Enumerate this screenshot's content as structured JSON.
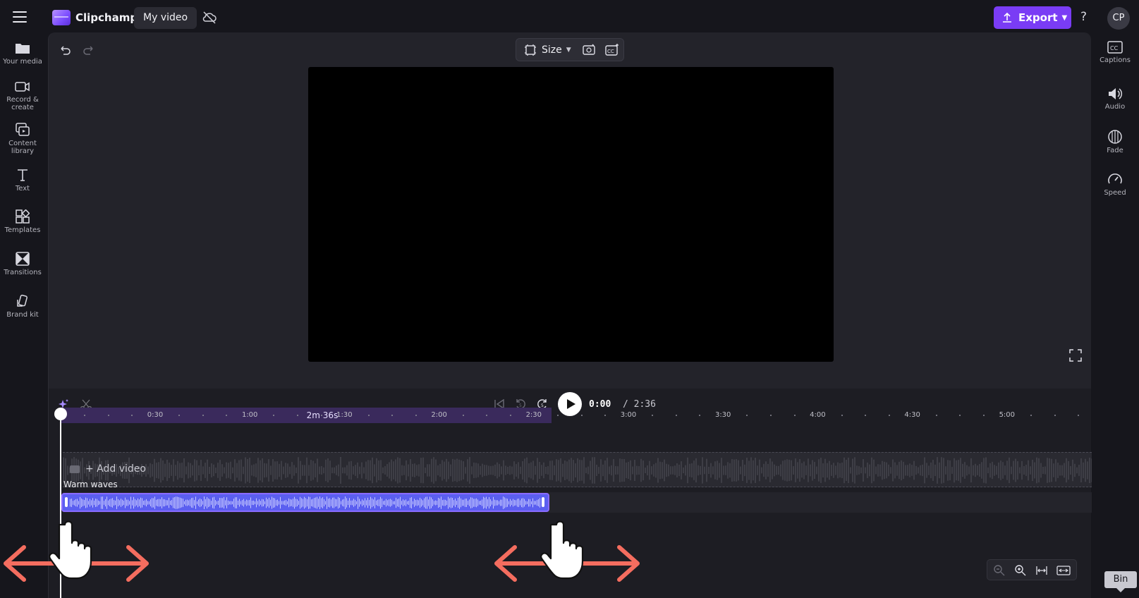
{
  "app": {
    "name": "Clipchamp",
    "project_title": "My video",
    "avatar_initials": "CP",
    "help": "?"
  },
  "export": {
    "label": "Export",
    "color": "#7a3cf5"
  },
  "left_rail": [
    {
      "icon": "folder-icon",
      "label": "Your media"
    },
    {
      "icon": "camera-icon",
      "label": "Record &",
      "label2": "create"
    },
    {
      "icon": "content-library-icon",
      "label": "Content",
      "label2": "library"
    },
    {
      "icon": "text-icon",
      "label": "Text"
    },
    {
      "icon": "templates-icon",
      "label": "Templates"
    },
    {
      "icon": "transitions-icon",
      "label": "Transitions"
    },
    {
      "icon": "brand-kit-icon",
      "label": "Brand kit"
    }
  ],
  "right_rail": [
    {
      "icon": "captions-icon",
      "label": "Captions"
    },
    {
      "icon": "audio-icon",
      "label": "Audio"
    },
    {
      "icon": "fade-icon",
      "label": "Fade"
    },
    {
      "icon": "speed-icon",
      "label": "Speed"
    }
  ],
  "preview_toolbar": {
    "size_label": "Size"
  },
  "playback": {
    "current": "0:00",
    "total": "/ 2:36"
  },
  "ruler": {
    "labels": [
      "0:30",
      "1:00",
      "1:30",
      "2:00",
      "2:30",
      "3:00",
      "3:30",
      "4:00",
      "4:30",
      "5:00"
    ],
    "duration_badge": "2m 36s"
  },
  "tracks": {
    "video_placeholder": "+ Add video",
    "audio_clip_name": "Warm waves",
    "audio_clip_color": "#5b5ff0"
  },
  "bin": {
    "label": "Bin"
  }
}
